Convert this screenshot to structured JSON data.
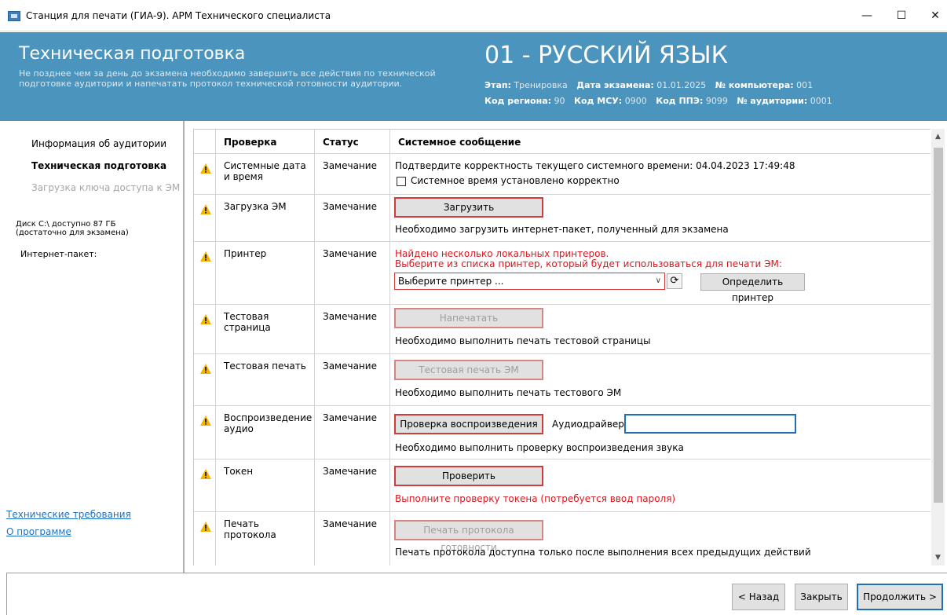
{
  "window": {
    "title": "Станция для печати (ГИА-9). АРМ Технического специалиста",
    "controls": {
      "minimize": "—",
      "maximize": "☐",
      "close": "✕"
    }
  },
  "header": {
    "title": "Техническая подготовка",
    "note": "Не позднее чем за день до экзамена необходимо завершить все действия по технической подготовке аудитории и напечатать протокол технической готовности аудитории.",
    "subject": "01 - РУССКИЙ ЯЗЫК",
    "meta": {
      "stage_label": "Этап:",
      "stage": "Тренировка",
      "exam_date_label": "Дата экзамена:",
      "exam_date": "01.01.2025",
      "computer_label": "№ компьютера:",
      "computer": "001",
      "region_label": "Код региона:",
      "region": "90",
      "msu_label": "Код МСУ:",
      "msu": "0900",
      "ppe_label": "Код ППЭ:",
      "ppe": "9099",
      "room_label": "№ аудитории:",
      "room": "0001"
    },
    "colors": {
      "background": "#4b94bd"
    }
  },
  "sidebar": {
    "items": [
      {
        "label": "Информация об аудитории",
        "state": "normal"
      },
      {
        "label": "Техническая подготовка",
        "state": "active"
      },
      {
        "label": "Загрузка ключа доступа к ЭМ",
        "state": "disabled"
      }
    ],
    "disk": "Диск С:\\ доступно 87 ГБ\n(достаточно для экзамена)",
    "internet_package": "Интернет-пакет:",
    "links": {
      "tech_requirements": "Технические требования",
      "about": "О программе"
    }
  },
  "table": {
    "columns": [
      "Проверка",
      "Статус",
      "Системное сообщение"
    ],
    "rows": [
      {
        "check": "Системные дата и время",
        "status": "Замечание",
        "icon": "warning-icon",
        "message": "Подтвердите корректность текущего системного времени: 04.04.2023 17:49:48",
        "checkbox_label": "Системное время установлено корректно",
        "checkbox_checked": false
      },
      {
        "check": "Загрузка ЭМ",
        "status": "Замечание",
        "icon": "warning-icon",
        "button": "Загрузить",
        "message": "Необходимо загрузить интернет-пакет, полученный для экзамена"
      },
      {
        "check": "Принтер",
        "status": "Замечание",
        "icon": "warning-icon",
        "message_red_1": "Найдено несколько локальных принтеров.",
        "message_red_2": "Выберите из списка принтер, который будет использоваться для печати ЭМ:",
        "select_value": "Выберите принтер ...",
        "refresh_icon": "refresh-icon",
        "detect_button": "Определить принтер"
      },
      {
        "check": "Тестовая страница",
        "status": "Замечание",
        "icon": "warning-icon",
        "button": "Напечатать",
        "button_disabled": true,
        "message": "Необходимо выполнить печать тестовой страницы"
      },
      {
        "check": "Тестовая печать",
        "status": "Замечание",
        "icon": "warning-icon",
        "button": "Тестовая печать ЭМ",
        "button_disabled": true,
        "message": "Необходимо выполнить печать тестового ЭМ"
      },
      {
        "check": "Воспроизведение аудио",
        "status": "Замечание",
        "icon": "warning-icon",
        "button": "Проверка воспроизведения",
        "audio_label": "Аудиодрайвер:",
        "audio_value": "",
        "message": "Необходимо выполнить проверку воспроизведения звука"
      },
      {
        "check": "Токен",
        "status": "Замечание",
        "icon": "warning-icon",
        "button": "Проверить",
        "message_red": "Выполните проверку токена (потребуется ввод пароля)"
      },
      {
        "check": "Печать протокола",
        "status": "Замечание",
        "icon": "warning-icon",
        "button": "Печать протокола готовности",
        "button_disabled": true,
        "message": "Печать протокола доступна только после выполнения всех предыдущих действий"
      }
    ]
  },
  "footer": {
    "back": "< Назад",
    "close": "Закрыть",
    "continue": "Продолжить >"
  },
  "colors": {
    "warning": "#f2b400",
    "error_text": "#e0141c",
    "link": "#1a73c9",
    "primary_border": "#1f6fb7"
  }
}
